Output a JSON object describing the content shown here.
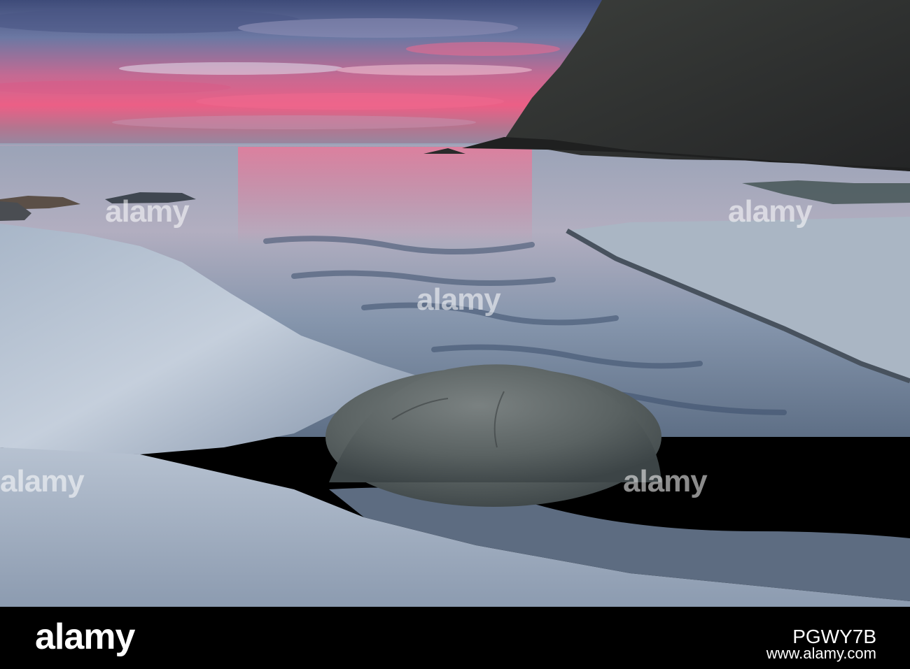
{
  "watermark": {
    "brand": "alamy",
    "center_mark": "a"
  },
  "footer": {
    "logo_text": "alamy",
    "image_id": "PGWY7B",
    "url": "www.alamy.com"
  },
  "colors": {
    "sky_pink": "#ec5f86",
    "sky_blue": "#6a7aa6",
    "water": "#a9b6c8",
    "sand": "#c8d2dc",
    "cliff": "#2b2c2c",
    "boulder": "#5b6262",
    "footer_bg": "#000000"
  }
}
